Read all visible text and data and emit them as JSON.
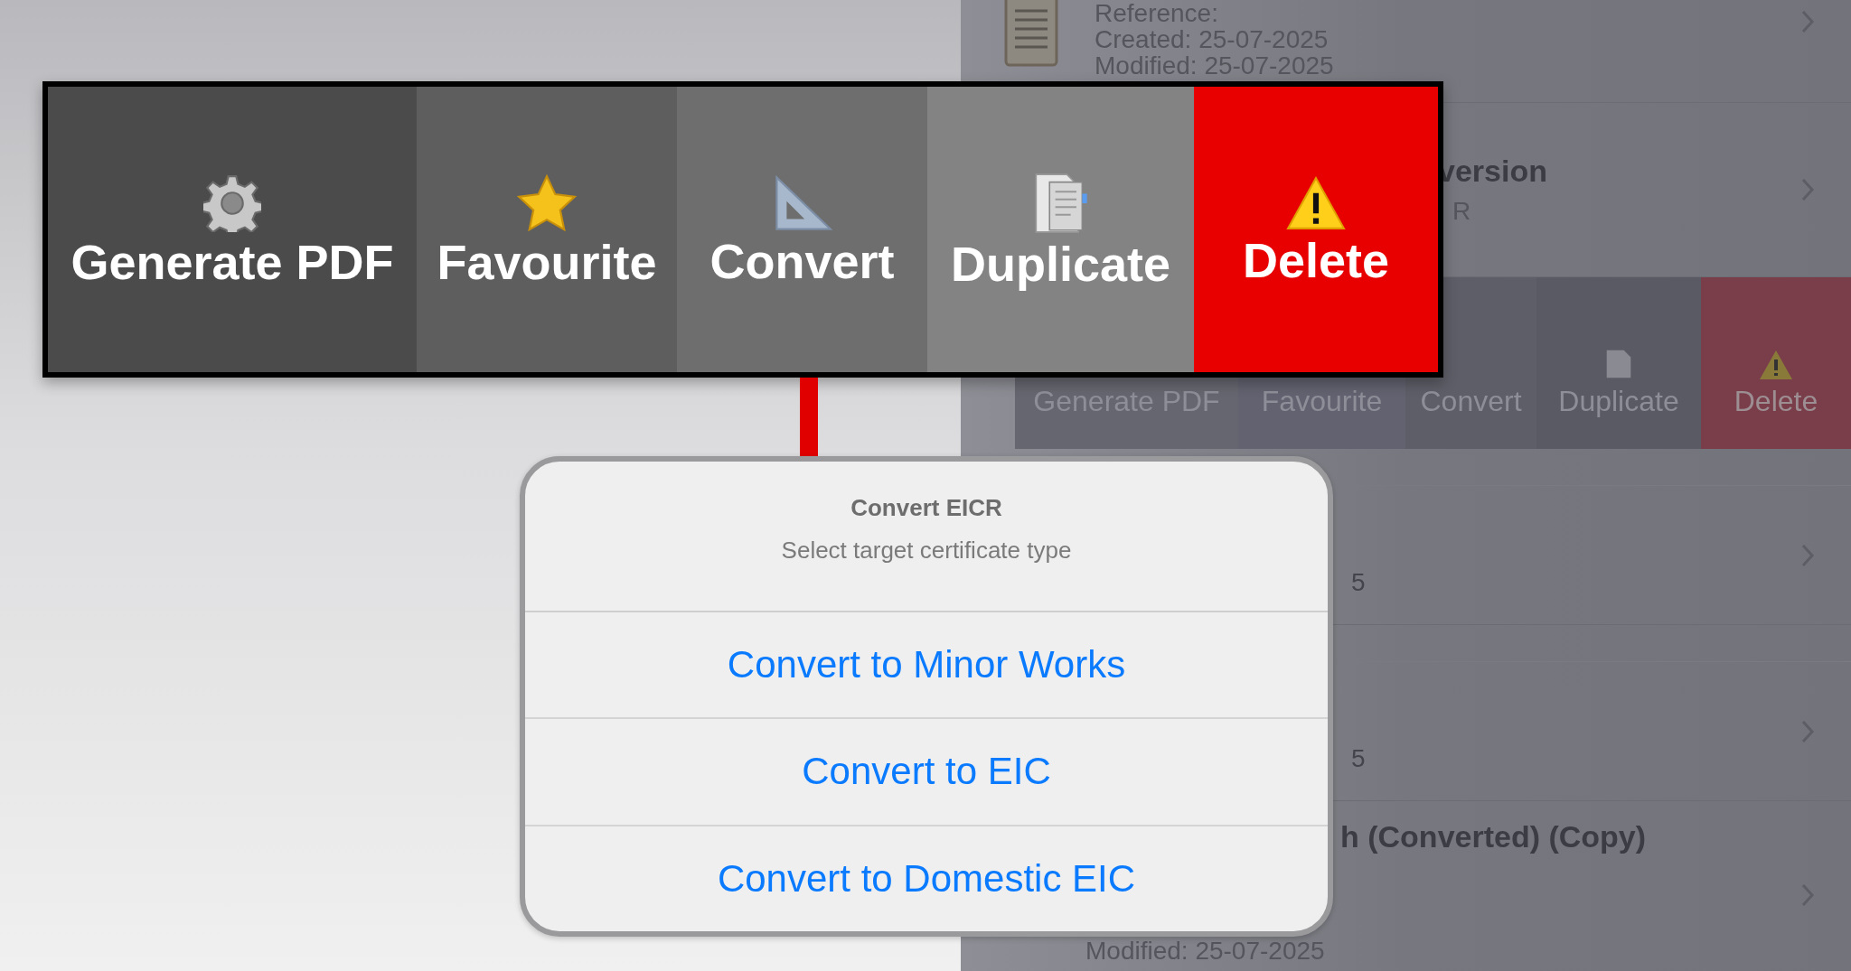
{
  "list_rows": [
    {
      "kind": "document",
      "lines": [
        "Reference:",
        "Created: 25-07-2025",
        "Modified: 25-07-2025"
      ]
    },
    {
      "kind": "title",
      "title": "version",
      "subtitle": "R"
    },
    {
      "kind": "actions",
      "actions": [
        {
          "label": "Generate PDF",
          "kind": "pdf"
        },
        {
          "label": "Favourite",
          "kind": "favourite"
        },
        {
          "label": "Convert",
          "kind": "convert"
        },
        {
          "label": "Duplicate",
          "kind": "duplicate"
        },
        {
          "label": "Delete",
          "kind": "delete"
        }
      ]
    },
    {
      "kind": "fragment",
      "lines": [
        "5"
      ]
    },
    {
      "kind": "fragment",
      "lines": [
        "5"
      ]
    },
    {
      "kind": "title",
      "title": "h (Converted) (Copy)",
      "subtitle": "Modified: 25-07-2025"
    }
  ],
  "callout": {
    "actions": [
      {
        "label": "Generate PDF",
        "kind": "pdf"
      },
      {
        "label": "Favourite",
        "kind": "favourite"
      },
      {
        "label": "Convert",
        "kind": "convert"
      },
      {
        "label": "Duplicate",
        "kind": "duplicate"
      },
      {
        "label": "Delete",
        "kind": "delete"
      }
    ]
  },
  "dialog": {
    "title": "Convert EICR",
    "message": "Select target certificate type",
    "options": [
      "Convert to Minor Works",
      "Convert to EIC",
      "Convert to Domestic EIC"
    ]
  }
}
